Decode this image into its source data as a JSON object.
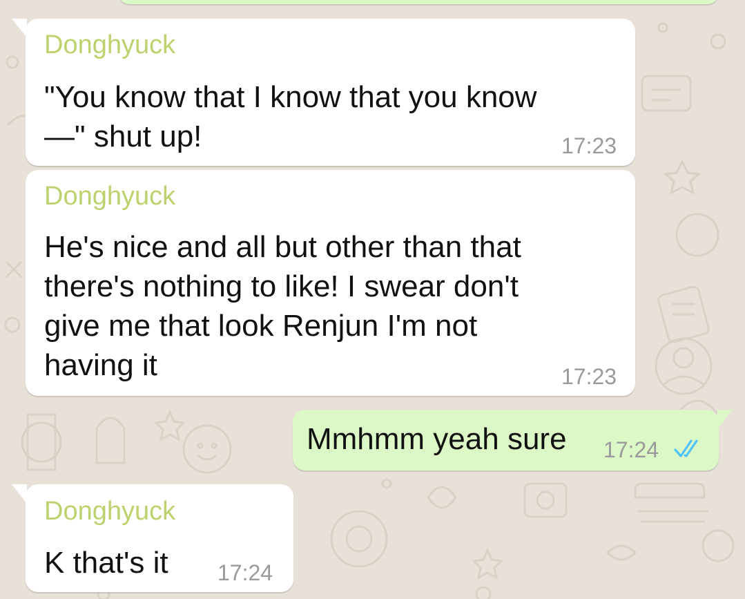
{
  "chat": {
    "messages": [
      {
        "direction": "incoming",
        "sender": "Donghyuck",
        "text": "\"You know that I know that you know\n—\" shut up!",
        "time": "17:23"
      },
      {
        "direction": "incoming",
        "sender": "Donghyuck",
        "text": "He's nice and all but other than that\nthere's nothing to like! I swear don't\ngive me that look Renjun I'm not\nhaving it",
        "time": "17:23"
      },
      {
        "direction": "outgoing",
        "text": "Mmhmm yeah sure",
        "time": "17:24",
        "status": "read",
        "status_icon": "double-check-icon"
      },
      {
        "direction": "incoming",
        "sender": "Donghyuck",
        "text": "K that's it",
        "time": "17:24"
      }
    ]
  },
  "colors": {
    "background": "#e7e1d8",
    "incoming_bubble": "#ffffff",
    "outgoing_bubble": "#dcf8c6",
    "sender_name": "#bcd36d",
    "timestamp": "#9a9a9a",
    "read_ticks": "#4fc3f7"
  }
}
